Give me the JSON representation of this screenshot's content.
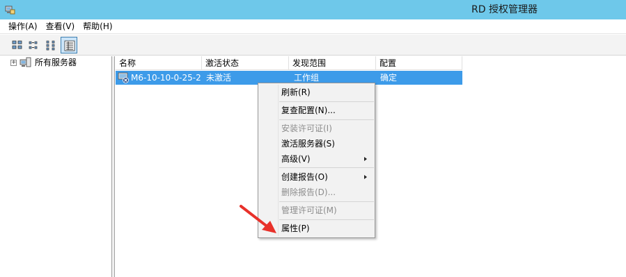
{
  "window": {
    "title": "RD 授权管理器"
  },
  "menu": [
    "操作(A)",
    "查看(V)",
    "帮助(H)"
  ],
  "toolbar": {
    "buttons": [
      {
        "icon": "large-icons-view-icon",
        "active": false
      },
      {
        "icon": "small-icons-view-icon",
        "active": false
      },
      {
        "icon": "list-view-icon",
        "active": false
      },
      {
        "icon": "details-view-icon",
        "active": true
      }
    ]
  },
  "tree": {
    "root_label": "所有服务器",
    "expander": "+"
  },
  "table": {
    "columns": [
      "名称",
      "激活状态",
      "发现范围",
      "配置"
    ],
    "rows": [
      {
        "name": "M6-10-10-0-25-2",
        "status": "未激活",
        "scope": "工作组",
        "config": "确定",
        "selected": true
      }
    ]
  },
  "context_menu": {
    "items": [
      {
        "label": "刷新(R)",
        "disabled": false,
        "submenu": false
      },
      {
        "label": "复查配置(N)...",
        "disabled": false,
        "submenu": false
      },
      {
        "label": "安装许可证(I)",
        "disabled": true,
        "submenu": false
      },
      {
        "label": "激活服务器(S)",
        "disabled": false,
        "submenu": false
      },
      {
        "label": "高级(V)",
        "disabled": false,
        "submenu": true
      },
      {
        "label": "创建报告(O)",
        "disabled": false,
        "submenu": true
      },
      {
        "label": "删除报告(D)...",
        "disabled": true,
        "submenu": false
      },
      {
        "label": "管理许可证(M)",
        "disabled": true,
        "submenu": false
      },
      {
        "label": "属性(P)",
        "disabled": false,
        "submenu": false
      }
    ]
  },
  "annotation": {
    "color": "#e8312a"
  },
  "colors": {
    "titlebar": "#6ec8ea",
    "selection": "#3d9be9"
  }
}
